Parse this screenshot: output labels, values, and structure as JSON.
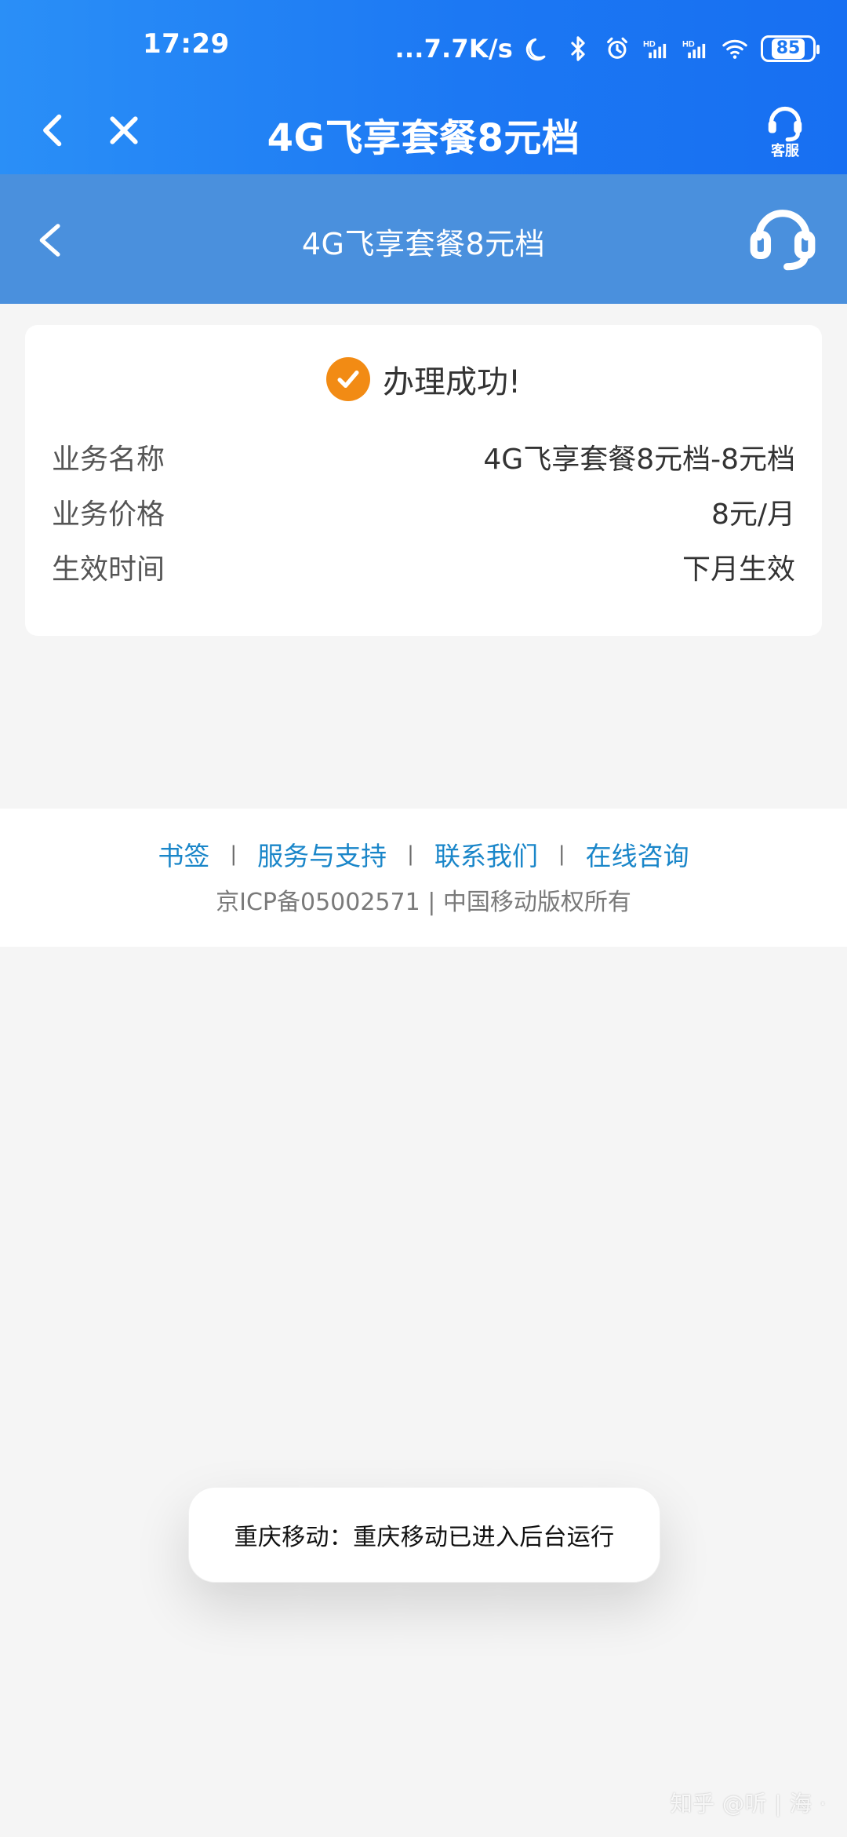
{
  "status_bar": {
    "time": "17:29",
    "network_speed": "...7.7K/s",
    "battery": "85",
    "icons": [
      "moon-icon",
      "bluetooth-icon",
      "alarm-icon",
      "signal-hd-icon",
      "signal-hd-icon",
      "wifi-icon",
      "battery-icon"
    ]
  },
  "header": {
    "title": "4G飞享套餐8元档",
    "customer_service_label": "客服",
    "icons": {
      "back": "chevron-left-icon",
      "close": "close-icon",
      "service": "headset-icon"
    }
  },
  "subheader": {
    "title": "4G飞享套餐8元档",
    "icons": {
      "back": "chevron-left-icon",
      "service": "headset-icon"
    }
  },
  "result_card": {
    "status": "办理成功!",
    "rows": [
      {
        "label": "业务名称",
        "value": "4G飞享套餐8元档-8元档"
      },
      {
        "label": "业务价格",
        "value": "8元/月"
      },
      {
        "label": "生效时间",
        "value": "下月生效"
      }
    ],
    "accent_color": "#f28b14"
  },
  "footer": {
    "links": [
      "书签",
      "服务与支持",
      "联系我们",
      "在线咨询"
    ],
    "separator": "|",
    "copyright": "京ICP备05002571 | 中国移动版权所有",
    "link_color": "#1a86c9"
  },
  "toast": {
    "message": "重庆移动：重庆移动已进入后台运行"
  },
  "watermark": {
    "text": "知乎 @听 | 海 ·"
  },
  "colors": {
    "primary_blue": "#1c78f3",
    "secondary_blue": "#4a90dd",
    "background": "#f5f5f5"
  }
}
